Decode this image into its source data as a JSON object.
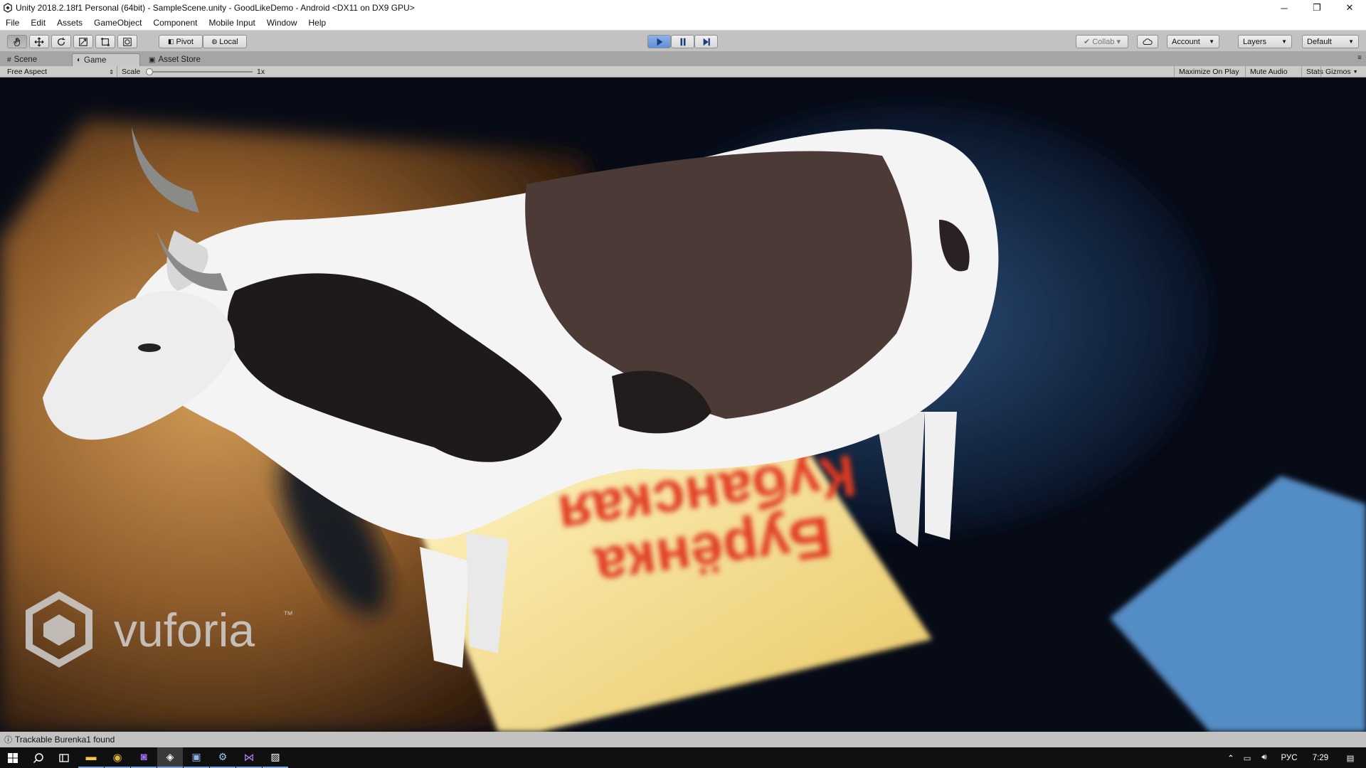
{
  "window": {
    "title": "Unity 2018.2.18f1 Personal (64bit) - SampleScene.unity - GoodLikeDemo - Android <DX11 on DX9 GPU>",
    "minimize": "─",
    "restore": "❐",
    "close": "✕"
  },
  "menu": [
    "File",
    "Edit",
    "Assets",
    "GameObject",
    "Component",
    "Mobile Input",
    "Window",
    "Help"
  ],
  "toolbar": {
    "pivot": "Pivot",
    "local": "Local",
    "collab": "Collab ▾",
    "account": "Account",
    "layers": "Layers",
    "layout": "Default"
  },
  "tabs": [
    {
      "label": "Scene",
      "icon": "grid-icon"
    },
    {
      "label": "Game",
      "icon": "pacman-icon"
    },
    {
      "label": "Asset Store",
      "icon": "bag-icon"
    }
  ],
  "gamebar": {
    "aspect": "Free Aspect",
    "scale_label": "Scale",
    "scale_value": "1x",
    "maximize": "Maximize On Play",
    "mute": "Mute Audio",
    "stats": "Stats",
    "gizmos": "Gizmos"
  },
  "viewport": {
    "logo_text": "vuforia",
    "tm": "™",
    "marker_line1": "Бурёнка",
    "marker_line2": "Кубанская"
  },
  "status": {
    "message": "Trackable Burenka1 found"
  },
  "taskbar": {
    "language": "РУС",
    "time": "7:29"
  },
  "colors": {
    "toolbar_bg": "#c2c2c2",
    "play_accent": "#5f8fd9",
    "taskbar_bg": "#101010"
  }
}
